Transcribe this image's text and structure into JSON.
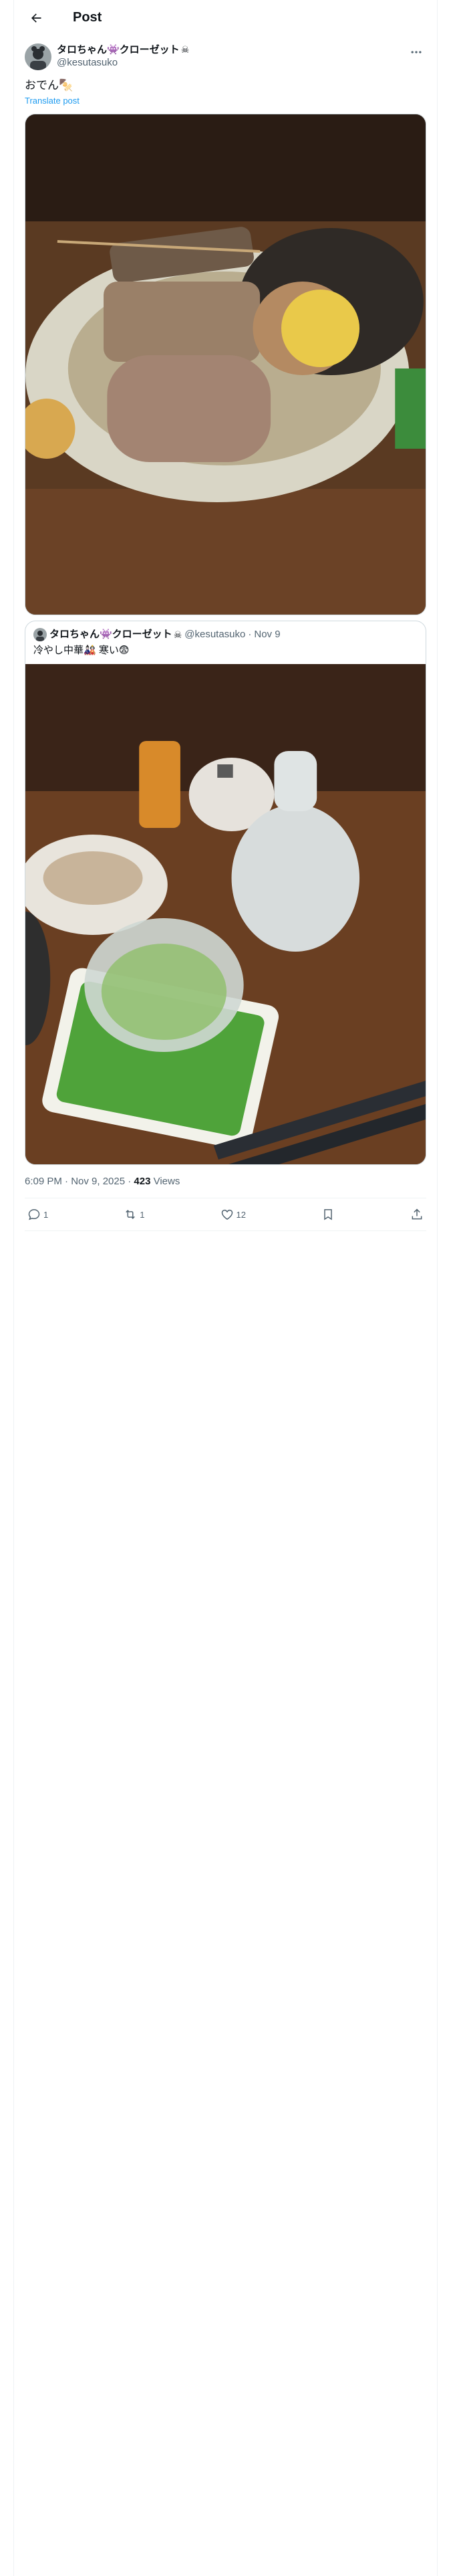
{
  "header": {
    "title": "Post"
  },
  "post": {
    "display_name": "タロちゃん👾クローゼット",
    "name_decoration": "☠",
    "handle": "@kesutasuko",
    "text": "おでん🍢",
    "translate_label": "Translate post",
    "image_alt": "Oden on a plate"
  },
  "quote": {
    "display_name": "タロちゃん👾クローゼット",
    "name_decoration": "☠",
    "handle": "@kesutasuko",
    "separator": "·",
    "date": "Nov 9",
    "text": "冷やし中華🎎 寒い😨"
  },
  "meta": {
    "time": "6:09 PM · Nov 9, 2025 · ",
    "views_count": "423",
    "views_label": " Views"
  },
  "actions": {
    "replies": "1",
    "reposts": "1",
    "likes": "12"
  },
  "icons": {
    "back": "back-arrow-icon",
    "more": "more-dots-icon",
    "reply": "reply-icon",
    "repost": "repost-icon",
    "like": "heart-icon",
    "bookmark": "bookmark-icon",
    "share": "share-icon"
  },
  "colors": {
    "link": "#1d9bf0",
    "secondary": "#536471",
    "border": "#cfd9de"
  }
}
